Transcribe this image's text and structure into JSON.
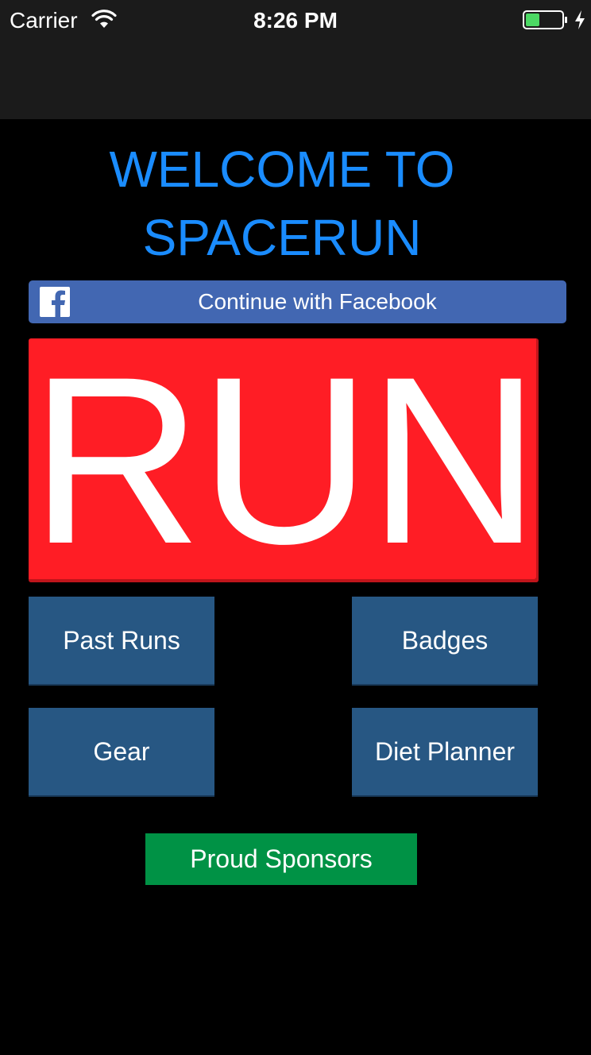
{
  "status_bar": {
    "carrier": "Carrier",
    "time": "8:26 PM",
    "wifi_icon": "wifi-icon",
    "battery_icon": "battery-charging-icon"
  },
  "main": {
    "title": "WELCOME TO SPACERUN",
    "facebook_button": {
      "label": "Continue with Facebook",
      "icon": "facebook-icon",
      "color": "#4267b2"
    },
    "run_button": {
      "label": "RUN",
      "color": "#ff1d25"
    },
    "menu_buttons": [
      {
        "label": "Past Runs"
      },
      {
        "label": "Badges"
      },
      {
        "label": "Gear"
      },
      {
        "label": "Diet Planner"
      }
    ],
    "menu_button_color": "#275783",
    "sponsors_button": {
      "label": "Proud Sponsors",
      "color": "#009245"
    },
    "title_color": "#1a8cff"
  }
}
